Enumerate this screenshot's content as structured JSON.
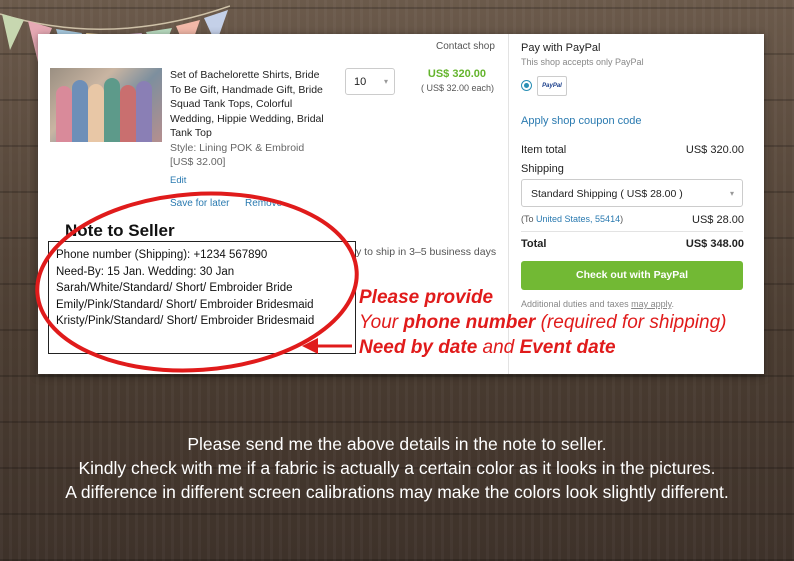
{
  "cart": {
    "contact_label": "Contact shop",
    "item": {
      "title_lines": [
        "Set of Bachelorette Shirts, Bride",
        "To Be Gift, Handmade Gift, Bride",
        "Squad Tank Tops, Colorful",
        "Wedding, Hippie Wedding, Bridal",
        "Tank Top"
      ],
      "style": "Style: Lining POK & Embroid",
      "unit_price": "[US$ 32.00]",
      "edit_label": "Edit",
      "quantity": "10",
      "price": "US$ 320.00",
      "price_each": "( US$ 32.00 each)",
      "save_later_label": "Save for later",
      "remove_label": "Remove",
      "ship_time": "y to ship in 3–5 business days"
    },
    "note": {
      "title": "Note to Seller",
      "lines": [
        "Phone number (Shipping): +1234 567890",
        "Need-By: 15 Jan. Wedding: 30 Jan",
        "Sarah/White/Standard/ Short/ Embroider Bride",
        "Emily/Pink/Standard/ Short/ Embroider Bridesmaid",
        "Kristy/Pink/Standard/ Short/ Embroider Bridesmaid"
      ]
    }
  },
  "payment": {
    "title": "Pay with PayPal",
    "subtitle": "This shop accepts only PayPal",
    "paypal_logo": "PayPal",
    "coupon_label": "Apply shop coupon code",
    "item_total_label": "Item total",
    "item_total_value": "US$ 320.00",
    "shipping_label": "Shipping",
    "shipping_option": "Standard Shipping ( US$ 28.00 )",
    "to_prefix": "(To ",
    "to_location": "United States, 55414",
    "to_suffix": ")",
    "shipping_value": "US$ 28.00",
    "total_label": "Total",
    "total_value": "US$ 348.00",
    "checkout_label": "Check out with PayPal",
    "duties_prefix": "Additional duties and taxes ",
    "duties_link": "may apply",
    "duties_suffix": "."
  },
  "annotation": {
    "line1": "Please provide",
    "line2_a": "Your ",
    "line2_b": "phone number",
    "line2_c": " (required for shipping)",
    "line3_a": "Need by date",
    "line3_b": " and ",
    "line3_c": "Event date",
    "color": "#e01b1b"
  },
  "caption": {
    "lines": [
      "Please send me the above details in the note to seller.",
      "Kindly check with me if a fabric is actually a certain color as it looks in the pictures.",
      "A difference in different screen calibrations may make the colors look slightly different."
    ]
  },
  "colors": {
    "accent_green": "#72b934",
    "price_green": "#64b42d",
    "link_blue": "#2a7ab0"
  }
}
